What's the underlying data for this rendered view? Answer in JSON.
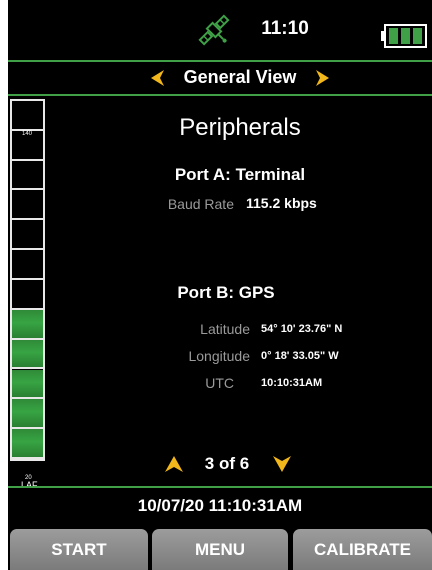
{
  "status_bar": {
    "time": "11:10",
    "icons": [
      "satellite-icon",
      "battery-icon"
    ],
    "battery_level_percent": 100
  },
  "view_selector": {
    "title": "General View",
    "icons": [
      "chevron-left-icon",
      "chevron-right-icon"
    ]
  },
  "level_meter": {
    "top_label": "140",
    "bottom_value": "20",
    "bottom_unit": "LAF",
    "segments_total": 12,
    "segments_lit": 5,
    "lit_color": "#37a443"
  },
  "main": {
    "title": "Peripherals",
    "port_a": {
      "heading": "Port A: Terminal",
      "baud_rate_label": "Baud Rate",
      "baud_rate_value": "115.2 kbps"
    },
    "port_b": {
      "heading": "Port B: GPS",
      "latitude_label": "Latitude",
      "latitude_value": "54° 10' 23.76\" N",
      "longitude_label": "Longitude",
      "longitude_value": "0° 18' 33.05\" W",
      "utc_label": "UTC",
      "utc_value": "10:10:31AM"
    }
  },
  "pager": {
    "text": "3 of 6",
    "icons": [
      "arrow-up-icon",
      "arrow-down-icon"
    ]
  },
  "datetime": "10/07/20 11:10:31AM",
  "softkeys": {
    "start": "START",
    "menu": "MENU",
    "calibrate": "CALIBRATE"
  },
  "colors": {
    "accent_green": "#3fa047",
    "arrow_yellow": "#f2b71a",
    "background": "#000000",
    "softkey_gray": "#8c8c8c"
  }
}
